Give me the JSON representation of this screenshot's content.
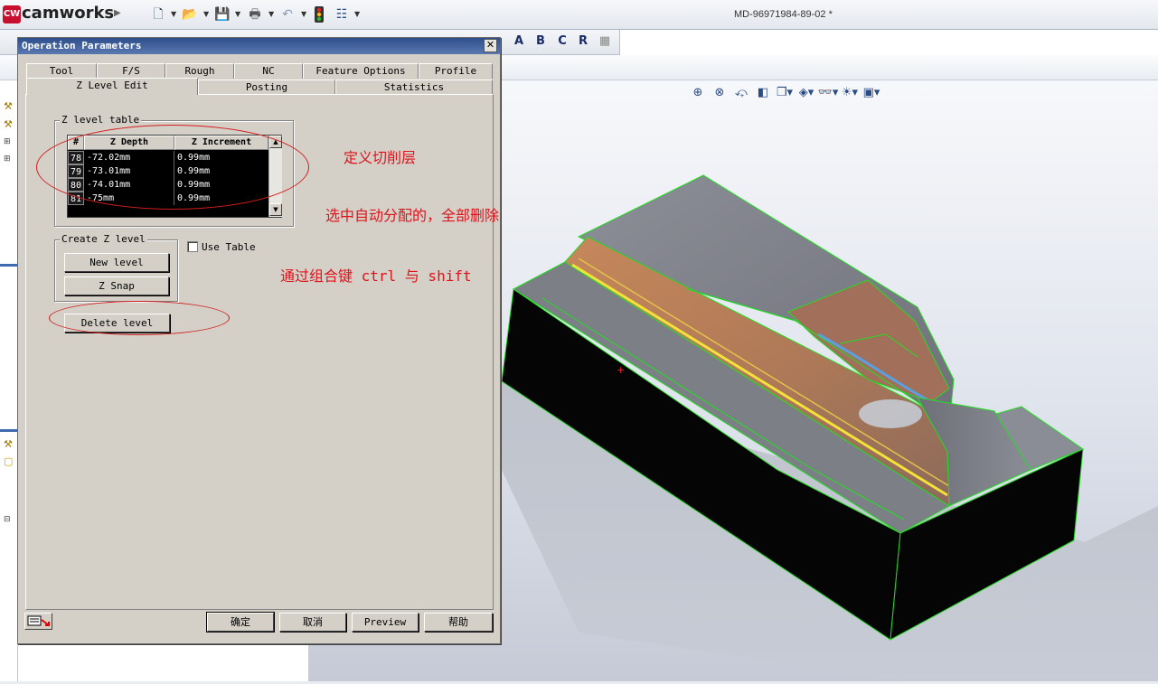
{
  "app": {
    "logo_text": "CW",
    "name": "camworks",
    "document_title": "MD-96971984-89-02 *"
  },
  "toolbar_icons": [
    "new-file-icon",
    "open-folder-icon",
    "save-icon",
    "print-icon",
    "undo-icon",
    "traffic-light-icon",
    "options-list-icon"
  ],
  "viewport_toolbar_icons": [
    "zoom-fit-icon",
    "zoom-area-icon",
    "zoom-previous-icon",
    "section-view-icon",
    "view-orientation-icon",
    "display-style-icon",
    "hide-show-icon",
    "edit-appearance-icon",
    "scene-icon"
  ],
  "dialog": {
    "title": "Operation Parameters",
    "close_label": "✕",
    "tabs_row1": [
      {
        "label": "Tool"
      },
      {
        "label": "F/S"
      },
      {
        "label": "Rough"
      },
      {
        "label": "NC"
      },
      {
        "label": "Feature Options"
      },
      {
        "label": "Profile"
      }
    ],
    "tabs_row2": [
      {
        "label": "Z Level Edit",
        "active": true
      },
      {
        "label": "Posting"
      },
      {
        "label": "Statistics"
      }
    ],
    "z_level_table": {
      "label": "Z level table",
      "columns": [
        "#",
        "Z Depth",
        "Z Increment"
      ],
      "rows": [
        {
          "n": "78",
          "depth": "-72.02mm",
          "increment": "0.99mm"
        },
        {
          "n": "79",
          "depth": "-73.01mm",
          "increment": "0.99mm"
        },
        {
          "n": "80",
          "depth": "-74.01mm",
          "increment": "0.99mm"
        },
        {
          "n": "81",
          "depth": "-75mm",
          "increment": "0.99mm"
        }
      ]
    },
    "create_z_level": {
      "label": "Create Z level",
      "new_level_label": "New level",
      "z_snap_label": "Z Snap"
    },
    "use_table_label": "Use Table",
    "use_table_checked": false,
    "delete_level_label": "Delete level",
    "footer": {
      "ok_label": "确定",
      "cancel_label": "取消",
      "preview_label": "Preview",
      "help_label": "帮助"
    }
  },
  "annotations": {
    "define_layers": "定义切削层",
    "select_auto_delete": "选中自动分配的，全部删除",
    "combo_keys": "通过组合键 ctrl 与 shift"
  },
  "colors": {
    "title_bar": "#2e4f8c",
    "dialog_bg": "#d4d0c8",
    "annotation_red": "#e0131b",
    "model_edge_green": "#22dd22"
  }
}
